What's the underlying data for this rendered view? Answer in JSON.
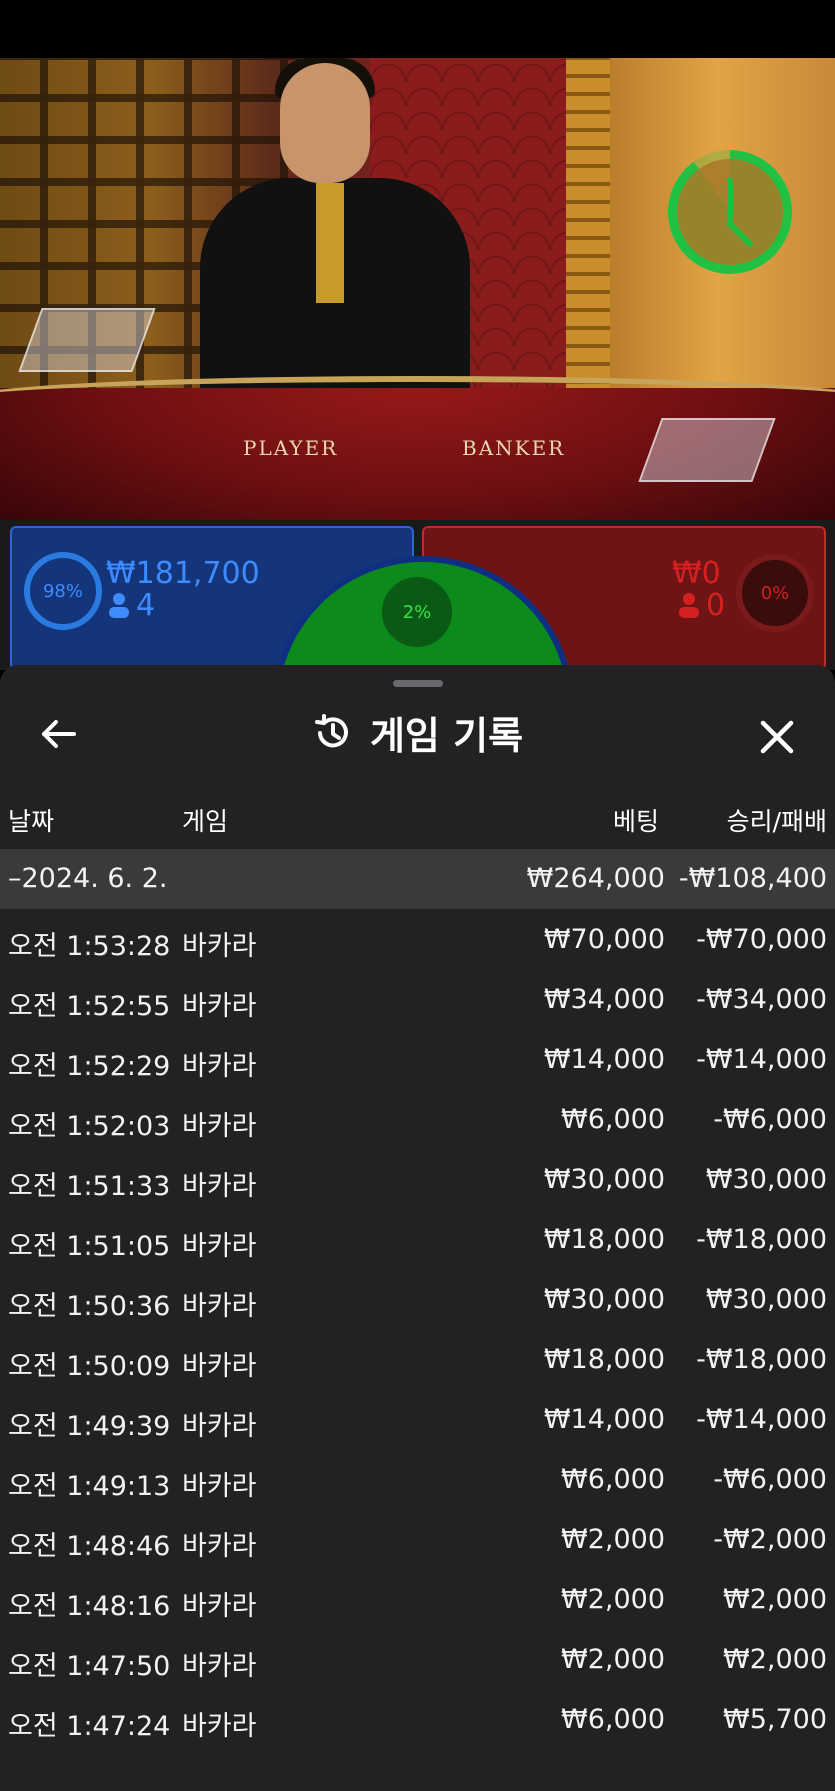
{
  "player": {
    "percent": "98%",
    "amount": "₩181,700",
    "count": "4"
  },
  "banker": {
    "percent": "0%",
    "amount": "₩0",
    "count": "0"
  },
  "tie": {
    "percent": "2%"
  },
  "scene": {
    "player_label": "PLAYER",
    "banker_label": "BANKER"
  },
  "sheet": {
    "title": "게임 기록",
    "columns": {
      "date": "날짜",
      "game": "게임",
      "bet": "베팅",
      "result": "승리/패배"
    },
    "summary": {
      "date": "–2024. 6. 2.",
      "bet": "₩264,000",
      "result": "-₩108,400"
    },
    "rows": [
      {
        "time": "오전 1:53:28",
        "game": "바카라",
        "bet": "₩70,000",
        "result": "-₩70,000"
      },
      {
        "time": "오전 1:52:55",
        "game": "바카라",
        "bet": "₩34,000",
        "result": "-₩34,000"
      },
      {
        "time": "오전 1:52:29",
        "game": "바카라",
        "bet": "₩14,000",
        "result": "-₩14,000"
      },
      {
        "time": "오전 1:52:03",
        "game": "바카라",
        "bet": "₩6,000",
        "result": "-₩6,000"
      },
      {
        "time": "오전 1:51:33",
        "game": "바카라",
        "bet": "₩30,000",
        "result": "₩30,000"
      },
      {
        "time": "오전 1:51:05",
        "game": "바카라",
        "bet": "₩18,000",
        "result": "-₩18,000"
      },
      {
        "time": "오전 1:50:36",
        "game": "바카라",
        "bet": "₩30,000",
        "result": "₩30,000"
      },
      {
        "time": "오전 1:50:09",
        "game": "바카라",
        "bet": "₩18,000",
        "result": "-₩18,000"
      },
      {
        "time": "오전 1:49:39",
        "game": "바카라",
        "bet": "₩14,000",
        "result": "-₩14,000"
      },
      {
        "time": "오전 1:49:13",
        "game": "바카라",
        "bet": "₩6,000",
        "result": "-₩6,000"
      },
      {
        "time": "오전 1:48:46",
        "game": "바카라",
        "bet": "₩2,000",
        "result": "-₩2,000"
      },
      {
        "time": "오전 1:48:16",
        "game": "바카라",
        "bet": "₩2,000",
        "result": "₩2,000"
      },
      {
        "time": "오전 1:47:50",
        "game": "바카라",
        "bet": "₩2,000",
        "result": "₩2,000"
      },
      {
        "time": "오전 1:47:24",
        "game": "바카라",
        "bet": "₩6,000",
        "result": "₩5,700"
      }
    ]
  },
  "icons": [
    "back-arrow-icon",
    "history-icon",
    "close-icon",
    "clock-icon",
    "person-icon"
  ],
  "colors": {
    "player_blue": "#2a7be0",
    "banker_red": "#c62828",
    "tie_green": "#21c244",
    "sheet_bg": "#222224"
  }
}
